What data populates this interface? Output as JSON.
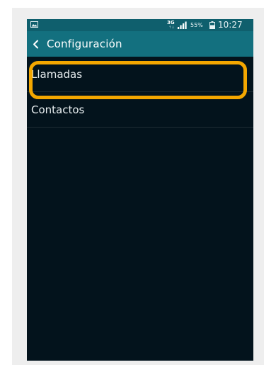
{
  "status_bar": {
    "gallery_icon": "image-icon",
    "network_type": "3G",
    "network_sub": "↑↓",
    "signal_icon": "signal-icon",
    "battery_percent": "55%",
    "battery_icon": "battery-icon",
    "time": "10:27"
  },
  "action_bar": {
    "back_icon": "chevron-left-icon",
    "title": "Configuración"
  },
  "list": {
    "items": [
      {
        "label": "Llamadas",
        "highlighted": true
      },
      {
        "label": "Contactos",
        "highlighted": false
      }
    ]
  },
  "colors": {
    "status_bar": "#0f5f6d",
    "action_bar": "#13707f",
    "background": "#03131c",
    "highlight": "#f4a700"
  }
}
